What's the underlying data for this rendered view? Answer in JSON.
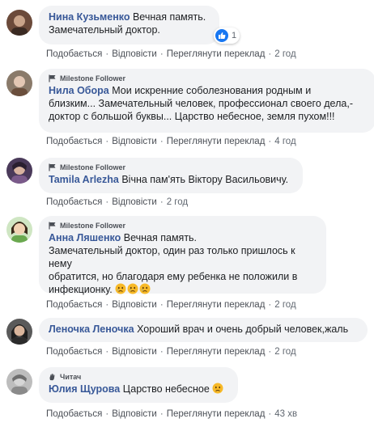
{
  "comments": [
    {
      "author": "Нина Кузьменко",
      "badge": "",
      "lines": [
        "Вечная память.",
        "Замечательный доктор."
      ],
      "reaction_count": "1",
      "actions": {
        "like": "Подобається",
        "reply": "Відповісти",
        "translate": "Переглянути переклад",
        "time": "2 год"
      },
      "avatar_colors": [
        "#6b4a3a",
        "#c9a48a"
      ]
    },
    {
      "author": "Нила Обора",
      "badge": "Milestone Follower",
      "lines": [
        "Мои искренние соболезнования родным и",
        "близким... Замечательный человек, профессионал своего дела,-",
        "доктор с большой буквы... Царство небесное, земля пухом!!!"
      ],
      "actions": {
        "like": "Подобається",
        "reply": "Відповісти",
        "translate": "Переглянути переклад",
        "time": "4 год"
      },
      "avatar_colors": [
        "#8a7a6a",
        "#e3c7b4"
      ]
    },
    {
      "author": "Tamila Arlezha",
      "badge": "Milestone Follower",
      "lines": [
        "Вічна пам'ять Віктору Васильовичу."
      ],
      "actions": {
        "like": "Подобається",
        "reply": "Відповісти",
        "time": "2 год"
      },
      "avatar_colors": [
        "#4a3a5a",
        "#d8b3a0"
      ]
    },
    {
      "author": "Анна Ляшенко",
      "badge": "Milestone Follower",
      "lines": [
        "Вечная память.",
        "Замечательный доктор, один раз только пришлось к нему",
        "обратится, но благодаря ему ребенка не положили в",
        "инфекционку."
      ],
      "actions": {
        "like": "Подобається",
        "reply": "Відповісти",
        "translate": "Переглянути переклад",
        "time": "2 год"
      },
      "avatar_colors": [
        "#6aa84f",
        "#f1d3b3"
      ]
    },
    {
      "author": "Леночка Леночка",
      "badge": "",
      "lines": [
        "Хороший врач и очень добрый человек,жаль"
      ],
      "actions": {
        "like": "Подобається",
        "reply": "Відповісти",
        "translate": "Переглянути переклад",
        "time": "2 год"
      },
      "avatar_colors": [
        "#2b2b2b",
        "#d9b59c"
      ]
    },
    {
      "author": "Юлия Щурова",
      "badge": "Читач",
      "lines": [
        "Царство небесное"
      ],
      "actions": {
        "like": "Подобається",
        "reply": "Відповісти",
        "translate": "Переглянути переклад",
        "time": "43 хв"
      },
      "avatar_colors": [
        "#9a9a9a",
        "#d6d6d6"
      ]
    }
  ]
}
